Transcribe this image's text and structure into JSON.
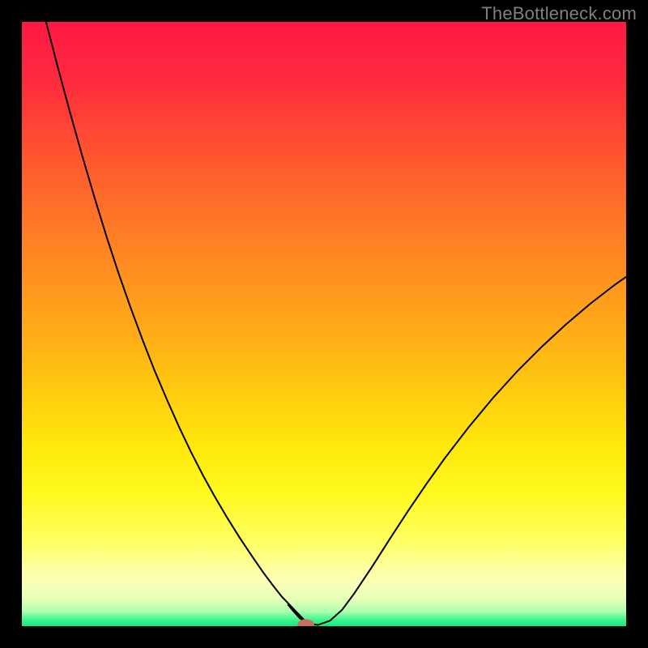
{
  "watermark": "TheBottleneck.com",
  "chart_data": {
    "type": "line",
    "title": "",
    "xlabel": "",
    "ylabel": "",
    "xlim": [
      0,
      100
    ],
    "ylim": [
      0,
      100
    ],
    "grid": false,
    "background_gradient_stops": [
      {
        "offset": 0,
        "color": "#ff1845"
      },
      {
        "offset": 0.1,
        "color": "#ff2b3e"
      },
      {
        "offset": 0.22,
        "color": "#ff5530"
      },
      {
        "offset": 0.35,
        "color": "#ff7d26"
      },
      {
        "offset": 0.48,
        "color": "#ffa21a"
      },
      {
        "offset": 0.6,
        "color": "#ffc710"
      },
      {
        "offset": 0.7,
        "color": "#ffe80b"
      },
      {
        "offset": 0.78,
        "color": "#fff81e"
      },
      {
        "offset": 0.86,
        "color": "#ffff63"
      },
      {
        "offset": 0.92,
        "color": "#fcffb3"
      },
      {
        "offset": 0.955,
        "color": "#e8ffb8"
      },
      {
        "offset": 0.975,
        "color": "#b0ffb0"
      },
      {
        "offset": 0.99,
        "color": "#3cf58b"
      },
      {
        "offset": 1.0,
        "color": "#10e987"
      }
    ],
    "series": [
      {
        "name": "bottleneck-curve",
        "color": "#000000",
        "x": [
          4.0,
          6.0,
          8.0,
          10.0,
          12.0,
          14.0,
          16.0,
          18.0,
          20.0,
          22.0,
          24.0,
          26.0,
          28.0,
          30.0,
          32.0,
          34.0,
          36.0,
          38.0,
          40.0,
          41.5,
          43.0,
          44.0,
          45.0,
          46.0,
          47.5,
          49.0,
          51.0,
          53.0,
          55.0,
          58.0,
          61.0,
          64.0,
          67.0,
          70.0,
          74.0,
          78.0,
          82.0,
          86.0,
          90.0,
          94.0,
          98.0,
          100.0
        ],
        "y": [
          100.0,
          92.3,
          84.9,
          77.8,
          71.0,
          64.5,
          58.4,
          52.7,
          47.3,
          42.2,
          37.5,
          33.0,
          28.8,
          24.9,
          21.3,
          17.9,
          14.7,
          11.7,
          8.8,
          6.8,
          4.9,
          3.6,
          2.4,
          1.3,
          0.4,
          0.2,
          0.9,
          2.7,
          5.4,
          9.9,
          14.6,
          19.2,
          23.6,
          27.8,
          33.0,
          37.8,
          42.2,
          46.2,
          49.9,
          53.3,
          56.4,
          57.8
        ]
      }
    ],
    "flat_segment": {
      "x_start": 43.0,
      "x_end": 47.5,
      "y": 0.2
    },
    "marker": {
      "name": "optimal-point",
      "x": 47.0,
      "y": 0.2,
      "color": "#cc6d63",
      "rx": 1.4,
      "ry": 0.95
    }
  }
}
